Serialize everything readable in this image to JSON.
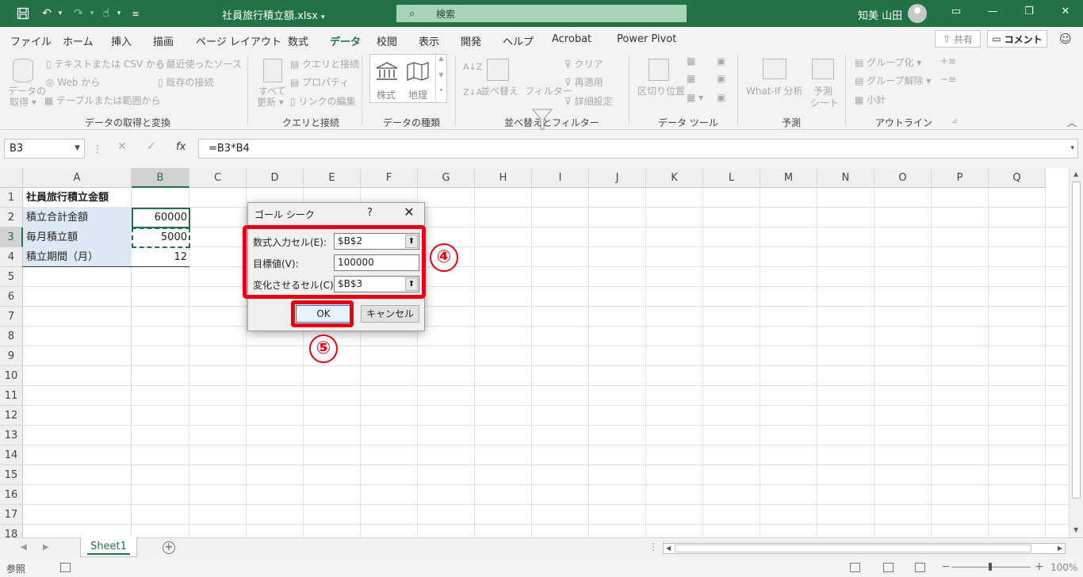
{
  "titlebar": {
    "document_title": "社員旅行積立額.xlsx",
    "search_placeholder": "検索",
    "user_name": "知美 山田"
  },
  "menu": {
    "tabs": [
      "ファイル",
      "ホーム",
      "挿入",
      "描画",
      "ページ レイアウト",
      "数式",
      "データ",
      "校閲",
      "表示",
      "開発",
      "ヘルプ",
      "Acrobat",
      "Power Pivot"
    ],
    "active_tab": "データ",
    "share_label": "共有",
    "comment_label": "コメント"
  },
  "ribbon": {
    "get_data": {
      "big_button_line1": "データの",
      "big_button_line2": "取得",
      "from_text_csv": "テキストまたは CSV から",
      "from_web": "Web から",
      "from_table": "テーブルまたは範囲から",
      "recent_sources": "最近使ったソース",
      "existing_connections": "既存の接続",
      "group_label": "データの取得と変換"
    },
    "queries": {
      "refresh_all_line1": "すべて",
      "refresh_all_line2": "更新",
      "queries_connections": "クエリと接続",
      "properties": "プロパティ",
      "edit_links": "リンクの編集",
      "group_label": "クエリと接続"
    },
    "data_types": {
      "stocks": "株式",
      "geography": "地理",
      "group_label": "データの種類"
    },
    "sort_filter": {
      "sort": "並べ替え",
      "filter": "フィルター",
      "clear": "クリア",
      "reapply": "再適用",
      "advanced": "詳細設定",
      "group_label": "並べ替えとフィルター"
    },
    "data_tools": {
      "text_to_columns": "区切り位置",
      "group_label": "データ ツール"
    },
    "forecast": {
      "what_if": "What-If 分析",
      "forecast_sheet_line1": "予測",
      "forecast_sheet_line2": "シート",
      "group_label": "予測"
    },
    "outline": {
      "group": "グループ化",
      "ungroup": "グループ解除",
      "subtotal": "小計",
      "group_label": "アウトライン"
    }
  },
  "formula_bar": {
    "name_box": "B3",
    "fx": "fx",
    "formula": "=B3*B4"
  },
  "grid": {
    "columns": [
      "A",
      "B",
      "C",
      "D",
      "E",
      "F",
      "G",
      "H",
      "I",
      "J",
      "K",
      "L",
      "M",
      "N",
      "O",
      "P",
      "Q"
    ],
    "rows": [
      "1",
      "2",
      "3",
      "4",
      "5",
      "6",
      "7",
      "8",
      "9",
      "10",
      "11",
      "12",
      "13",
      "14",
      "15",
      "16",
      "17",
      "18"
    ],
    "cells": {
      "A1": "社員旅行積立金額",
      "A2": "積立合計金額",
      "B2": "60000",
      "A3": "毎月積立額",
      "B3": "5000",
      "A4": "積立期間（月）",
      "B4": "12"
    }
  },
  "dialog": {
    "title": "ゴール シーク",
    "help": "?",
    "close": "✕",
    "set_cell_label": "数式入力セル(E):",
    "set_cell_value": "$B$2",
    "to_value_label": "目標値(V):",
    "to_value_value": "100000",
    "changing_cell_label": "変化させるセル(C):",
    "changing_cell_value": "$B$3",
    "ok": "OK",
    "cancel": "キャンセル"
  },
  "annotations": {
    "step4": "④",
    "step5": "⑤",
    "highlight_color": "#e60012"
  },
  "sheets": {
    "tabs": [
      "Sheet1"
    ]
  },
  "statusbar": {
    "mode": "参照",
    "zoom": "100%"
  },
  "colors": {
    "excel_green": "#217346",
    "label_fill": "#dde8f5"
  }
}
